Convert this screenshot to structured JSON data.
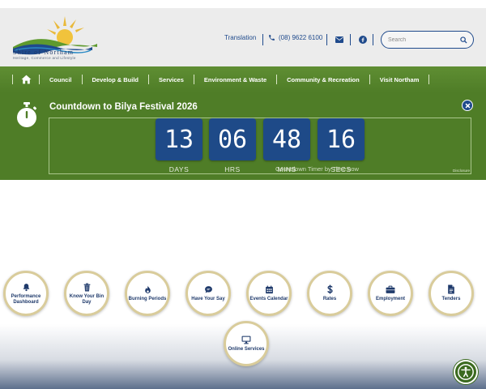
{
  "header": {
    "logo_name": "Shire of Northam",
    "logo_tagline": "Heritage, Commerce and Lifestyle",
    "translation_label": "Translation",
    "phone": "(08) 9622 6100",
    "search_placeholder": "Search"
  },
  "nav": {
    "items": [
      {
        "label": "Council"
      },
      {
        "label": "Develop & Build"
      },
      {
        "label": "Services"
      },
      {
        "label": "Environment & Waste"
      },
      {
        "label": "Community & Recreation"
      },
      {
        "label": "Visit Northam"
      }
    ]
  },
  "countdown": {
    "title": "Countdown to Bilya Festival 2026",
    "units": [
      {
        "value": "13",
        "label": "DAYS"
      },
      {
        "value": "06",
        "label": "HRS"
      },
      {
        "value": "48",
        "label": "MINS"
      },
      {
        "value": "16",
        "label": "SECS"
      }
    ],
    "credit": "Countdown Timer by Time.now",
    "small_note": "Disclosure"
  },
  "quick_links": [
    {
      "label": "Performance Dashboard",
      "icon": "bell-icon"
    },
    {
      "label": "Know Your Bin Day",
      "icon": "trash-icon"
    },
    {
      "label": "Burning Periods",
      "icon": "fire-icon"
    },
    {
      "label": "Have Your Say",
      "icon": "chat-icon"
    },
    {
      "label": "Events Calendar",
      "icon": "calendar-icon"
    },
    {
      "label": "Rates",
      "icon": "dollar-icon"
    },
    {
      "label": "Employment",
      "icon": "briefcase-icon"
    },
    {
      "label": "Tenders",
      "icon": "document-icon"
    },
    {
      "label": "Online Services",
      "icon": "monitor-icon"
    }
  ],
  "colors": {
    "brand_blue": "#1f4a8c",
    "brand_green": "#4f7d27",
    "ring_gold": "#d9cc9b"
  }
}
